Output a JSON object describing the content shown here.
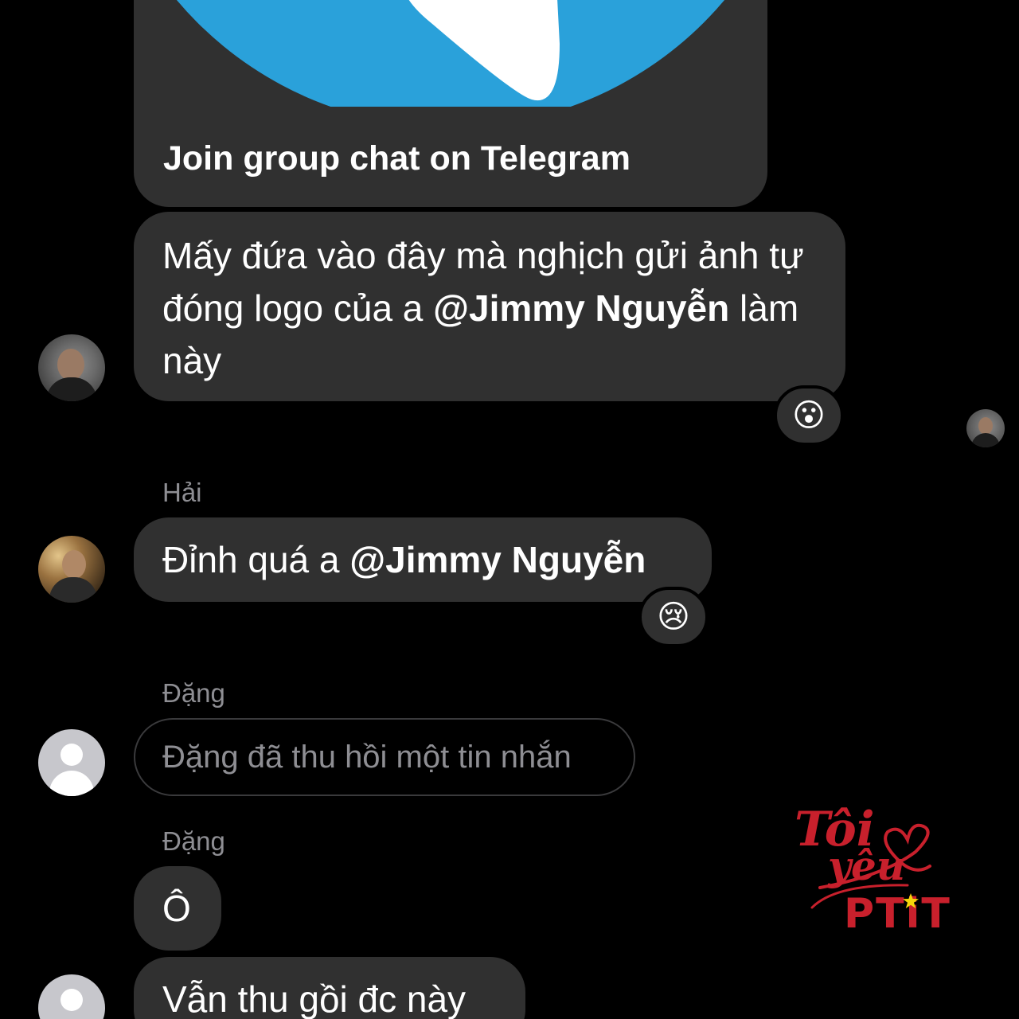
{
  "link_card": {
    "title": "Join group chat on Telegram",
    "brand_color": "#2AA1DA"
  },
  "messages": [
    {
      "text_before": "Mấy đứa vào đây mà nghịch gửi ảnh tự đóng logo của a ",
      "mention": "@Jimmy Nguyễn",
      "text_after": " làm này",
      "reaction": "😮"
    },
    {
      "sender": "Hải",
      "text_before": "Đỉnh quá a ",
      "mention": "@Jimmy Nguyễn",
      "reaction": "😢"
    },
    {
      "sender": "Đặng",
      "unsent_text": "Đặng đã thu hồi một tin nhắn"
    },
    {
      "sender": "Đặng",
      "text": "Ô"
    },
    {
      "text": "Vẫn thu gồi đc này"
    }
  ],
  "watermark": {
    "line1": "Tôi",
    "line2": "yêu",
    "line3": "PTiT",
    "color": "#C8202C",
    "star_color": "#F5D50A"
  },
  "icons": {
    "play": "telegram-plane-icon",
    "avatar_placeholder": "person-silhouette-icon"
  }
}
